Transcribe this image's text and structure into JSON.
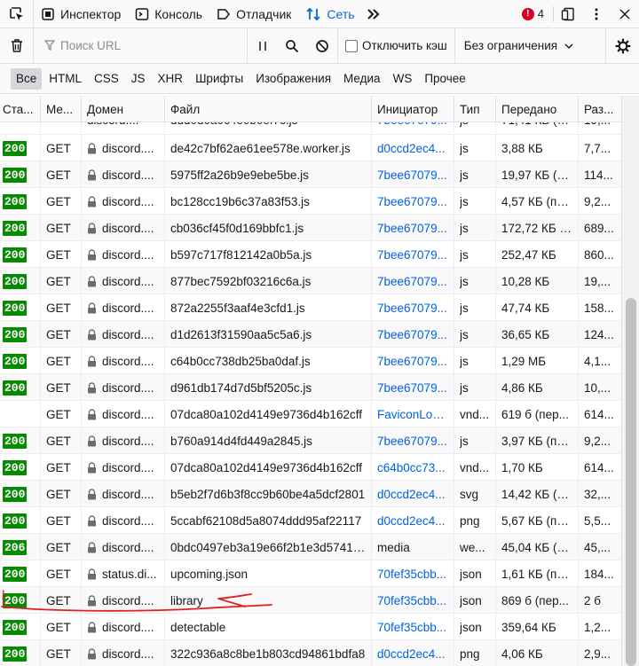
{
  "toolbar": {
    "tabs": [
      {
        "label": "Инспектор",
        "icon": "inspector-icon"
      },
      {
        "label": "Консоль",
        "icon": "console-icon"
      },
      {
        "label": "Отладчик",
        "icon": "debugger-icon"
      },
      {
        "label": "Сеть",
        "icon": "network-icon",
        "active": true
      }
    ],
    "error_count": "4",
    "colors": {
      "active": "#0a6ad4",
      "error": "#d70022"
    }
  },
  "filter": {
    "search_placeholder": "Поиск URL",
    "disable_cache_label": "Отключить кэш",
    "throttle_label": "Без ограничения"
  },
  "types": [
    "Все",
    "HTML",
    "CSS",
    "JS",
    "XHR",
    "Шрифты",
    "Изображения",
    "Медиа",
    "WS",
    "Прочее"
  ],
  "columns": [
    "Ста...",
    "Ме...",
    "Домен",
    "Файл",
    "Инициатор",
    "Тип",
    "Передано",
    "Раз..."
  ],
  "status_color": "#058b00",
  "requests": [
    {
      "status": "200",
      "method": "GET",
      "domain": "discord....",
      "file": "de42c7bf62ae61ee578e.worker.js",
      "initiator": "d0ccd2ec4...",
      "type": "js",
      "transferred": "3,88 КБ",
      "size": "7,7..."
    },
    {
      "status": "200",
      "method": "GET",
      "domain": "discord....",
      "file": "5975ff2a26b9e9ebe5be.js",
      "initiator": "7bee67079...",
      "type": "js",
      "transferred": "19,97 КБ (пе...",
      "size": "114..."
    },
    {
      "status": "200",
      "method": "GET",
      "domain": "discord....",
      "file": "bc128cc19b6c37a83f53.js",
      "initiator": "7bee67079...",
      "type": "js",
      "transferred": "4,57 КБ (пе...",
      "size": "9,2..."
    },
    {
      "status": "200",
      "method": "GET",
      "domain": "discord....",
      "file": "cb036cf45f0d169bbfc1.js",
      "initiator": "7bee67079...",
      "type": "js",
      "transferred": "172,72 КБ (...",
      "size": "689..."
    },
    {
      "status": "200",
      "method": "GET",
      "domain": "discord....",
      "file": "b597c717f812142a0b5a.js",
      "initiator": "7bee67079...",
      "type": "js",
      "transferred": "252,47 КБ",
      "size": "860..."
    },
    {
      "status": "200",
      "method": "GET",
      "domain": "discord....",
      "file": "877bec7592bf03216c6a.js",
      "initiator": "7bee67079...",
      "type": "js",
      "transferred": "10,28 КБ",
      "size": "19,..."
    },
    {
      "status": "200",
      "method": "GET",
      "domain": "discord....",
      "file": "872a2255f3aaf4e3cfd1.js",
      "initiator": "7bee67079...",
      "type": "js",
      "transferred": "47,74 КБ",
      "size": "158..."
    },
    {
      "status": "200",
      "method": "GET",
      "domain": "discord....",
      "file": "d1d2613f31590aa5c5a6.js",
      "initiator": "7bee67079...",
      "type": "js",
      "transferred": "36,65 КБ",
      "size": "124..."
    },
    {
      "status": "200",
      "method": "GET",
      "domain": "discord....",
      "file": "c64b0cc738db25ba0daf.js",
      "initiator": "7bee67079...",
      "type": "js",
      "transferred": "1,29 МБ",
      "size": "4,1..."
    },
    {
      "status": "200",
      "method": "GET",
      "domain": "discord....",
      "file": "d961db174d7d5bf5205c.js",
      "initiator": "7bee67079...",
      "type": "js",
      "transferred": "4,86 КБ",
      "size": "10,..."
    },
    {
      "status": "",
      "method": "GET",
      "domain": "discord....",
      "file": "07dca80a102d4149e9736d4b162cff",
      "initiator": "FaviconLoa...",
      "type": "vnd...",
      "transferred": "619 б (пер...",
      "size": "614..."
    },
    {
      "status": "200",
      "method": "GET",
      "domain": "discord....",
      "file": "b760a914d4fd449a2845.js",
      "initiator": "7bee67079...",
      "type": "js",
      "transferred": "3,97 КБ (пе...",
      "size": "9,2..."
    },
    {
      "status": "200",
      "method": "GET",
      "domain": "discord....",
      "file": "07dca80a102d4149e9736d4b162cff",
      "initiator": "c64b0cc73...",
      "type": "vnd...",
      "transferred": "1,70 КБ",
      "size": "614..."
    },
    {
      "status": "200",
      "method": "GET",
      "domain": "discord....",
      "file": "b5eb2f7d6b3f8cc9b60be4a5dcf2801",
      "initiator": "d0ccd2ec4...",
      "type": "svg",
      "transferred": "14,42 КБ (п...",
      "size": "32,..."
    },
    {
      "status": "200",
      "method": "GET",
      "domain": "discord....",
      "file": "5ccabf62108d5a8074ddd95af22117",
      "initiator": "d0ccd2ec4...",
      "type": "png",
      "transferred": "5,67 КБ (пе...",
      "size": "5,5..."
    },
    {
      "status": "206",
      "method": "GET",
      "domain": "discord....",
      "file": "0bdc0497eb3a19e66f2b1e3d574163",
      "initiator": "media",
      "type": "we...",
      "transferred": "45,04 КБ (п...",
      "size": "45,..."
    },
    {
      "status": "200",
      "method": "GET",
      "domain": "status.di...",
      "file": "upcoming.json",
      "initiator": "70fef35cbb...",
      "type": "json",
      "transferred": "1,61 КБ (пе...",
      "size": "184..."
    },
    {
      "status": "200",
      "method": "GET",
      "domain": "discord....",
      "file": "library",
      "initiator": "70fef35cbb...",
      "type": "json",
      "transferred": "869 б (пер...",
      "size": "2 б"
    },
    {
      "status": "200",
      "method": "GET",
      "domain": "discord....",
      "file": "detectable",
      "initiator": "70fef35cbb...",
      "type": "json",
      "transferred": "359,64 КБ",
      "size": "1,2..."
    },
    {
      "status": "200",
      "method": "GET",
      "domain": "discord....",
      "file": "322c936a8c8be1b803cd94861bdfa8",
      "initiator": "d0ccd2ec4...",
      "type": "png",
      "transferred": "4,06 КБ",
      "size": "2,9..."
    }
  ]
}
